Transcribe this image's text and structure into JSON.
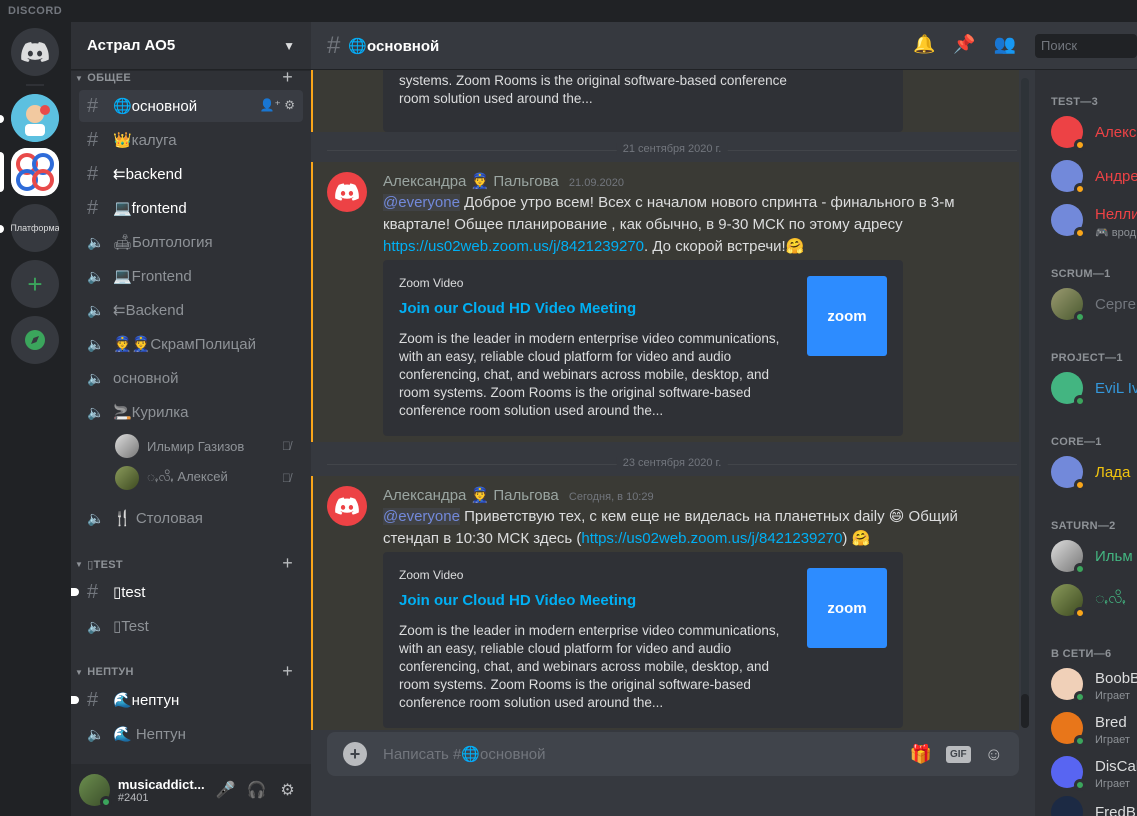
{
  "window": {
    "brand": "DISCORD"
  },
  "rail": {
    "server_platform_label": "Платформа"
  },
  "guild": {
    "name": "Астрал АО5"
  },
  "categories": [
    {
      "label": "ОБЩЕЕ"
    },
    {
      "label": "▯TEST"
    },
    {
      "label": "НЕПТУН"
    }
  ],
  "channels": [
    {
      "label": "🌐основной",
      "kind": "text",
      "active": true
    },
    {
      "label": "👑калуга",
      "kind": "text"
    },
    {
      "label": "⇇backend",
      "kind": "text",
      "unread": true
    },
    {
      "label": "💻frontend",
      "kind": "text",
      "unread": true
    },
    {
      "label": "🛋Болтология",
      "kind": "voice"
    },
    {
      "label": "💻Frontend",
      "kind": "voice"
    },
    {
      "label": "⇇Backend",
      "kind": "voice"
    },
    {
      "label": "👮👮СкрамПолицай",
      "kind": "voice"
    },
    {
      "label": "основной",
      "kind": "voice"
    },
    {
      "label": "🚬Курилка",
      "kind": "voice"
    },
    {
      "label": "🍴 Столовая",
      "kind": "voice"
    },
    {
      "label": "▯test",
      "kind": "text",
      "unread": true
    },
    {
      "label": "▯Test",
      "kind": "voice"
    },
    {
      "label": "🌊нептун",
      "kind": "text",
      "unread": true
    },
    {
      "label": "🌊 Нептун",
      "kind": "voice"
    }
  ],
  "voice_users": [
    {
      "name": "Ильмир Газизов"
    },
    {
      "name": "ꩻလိꩻ Алексей"
    }
  ],
  "user": {
    "name": "musicaddict...",
    "tag": "#2401"
  },
  "header": {
    "channel": "🌐основной",
    "search_placeholder": "Поиск"
  },
  "messages": [
    {
      "divider": "21 сентября 2020 г.",
      "author": "Александра 👮 Пальгова",
      "timestamp": "21.09.2020",
      "mention": "@everyone",
      "text1": " Доброе утро всем! Всех с началом нового спринта - финального в 3-м квартале! Общее планирование , как обычно, в 9-30 МСК по этому адресу ",
      "link": "https://us02web.zoom.us/j/8421239270",
      "text2": ".  До скорой встречи!🤗",
      "embed": {
        "provider": "Zoom Video",
        "title": "Join our Cloud HD Video Meeting",
        "description": "Zoom is the leader in modern enterprise video communications, with an easy, reliable cloud platform for video and audio conferencing, chat, and webinars across mobile, desktop, and room systems. Zoom Rooms is the original software-based conference room solution used around the...",
        "thumb": "zoom"
      }
    },
    {
      "divider": "23 сентября 2020 г.",
      "author": "Александра 👮 Пальгова",
      "timestamp": "Сегодня, в 10:29",
      "mention": "@everyone",
      "text1": " Приветствую тех, с кем еще не виделась на планетных daily 😄 Общий стендап  в 10:30 МСК здесь (",
      "link": "https://us02web.zoom.us/j/8421239270",
      "text2": ") 🤗",
      "embed": {
        "provider": "Zoom Video",
        "title": "Join our Cloud HD Video Meeting",
        "description": "Zoom is the leader in modern enterprise video communications, with an easy, reliable cloud platform for video and audio conferencing, chat, and webinars across mobile, desktop, and room systems. Zoom Rooms is the original software-based conference room solution used around the...",
        "thumb": "zoom"
      }
    }
  ],
  "truncated_embed_tail": "systems. Zoom Rooms is the original software-based conference room solution used around the...",
  "composer": {
    "placeholder": "Написать #🌐основной",
    "gif": "GIF"
  },
  "member_groups": [
    {
      "label": "TEST—3"
    },
    {
      "label": "SCRUM—1"
    },
    {
      "label": "PROJECT—1"
    },
    {
      "label": "CORE—1"
    },
    {
      "label": "SATURN—2"
    },
    {
      "label": "В СЕТИ—6"
    }
  ],
  "members": [
    {
      "name": "Алекс",
      "color": "#ed4245"
    },
    {
      "name": "Андре",
      "color": "#ed4245"
    },
    {
      "name": "Нелли",
      "color": "#ed4245",
      "sub": "🎮 врод"
    },
    {
      "name": "Серге",
      "color": "#72767d"
    },
    {
      "name": "EviL Iv",
      "color": "#3498db"
    },
    {
      "name": "Лада",
      "color": "#f1c40f"
    },
    {
      "name": "Ильм",
      "color": "#43b581"
    },
    {
      "name": "ꩻလိꩻ",
      "color": "#43b581"
    },
    {
      "name": "BoobB",
      "color": "#dcddde",
      "sub": "Играет"
    },
    {
      "name": "Bred",
      "color": "#dcddde",
      "sub": "Играет"
    },
    {
      "name": "DisCal",
      "color": "#dcddde",
      "sub": "Играет"
    },
    {
      "name": "FredB",
      "color": "#dcddde"
    }
  ],
  "colors": {
    "accent": "#7289da",
    "link": "#00b0f4",
    "online": "#3ba55c",
    "idle": "#faa61a",
    "mention_bar": "#faa61a"
  }
}
